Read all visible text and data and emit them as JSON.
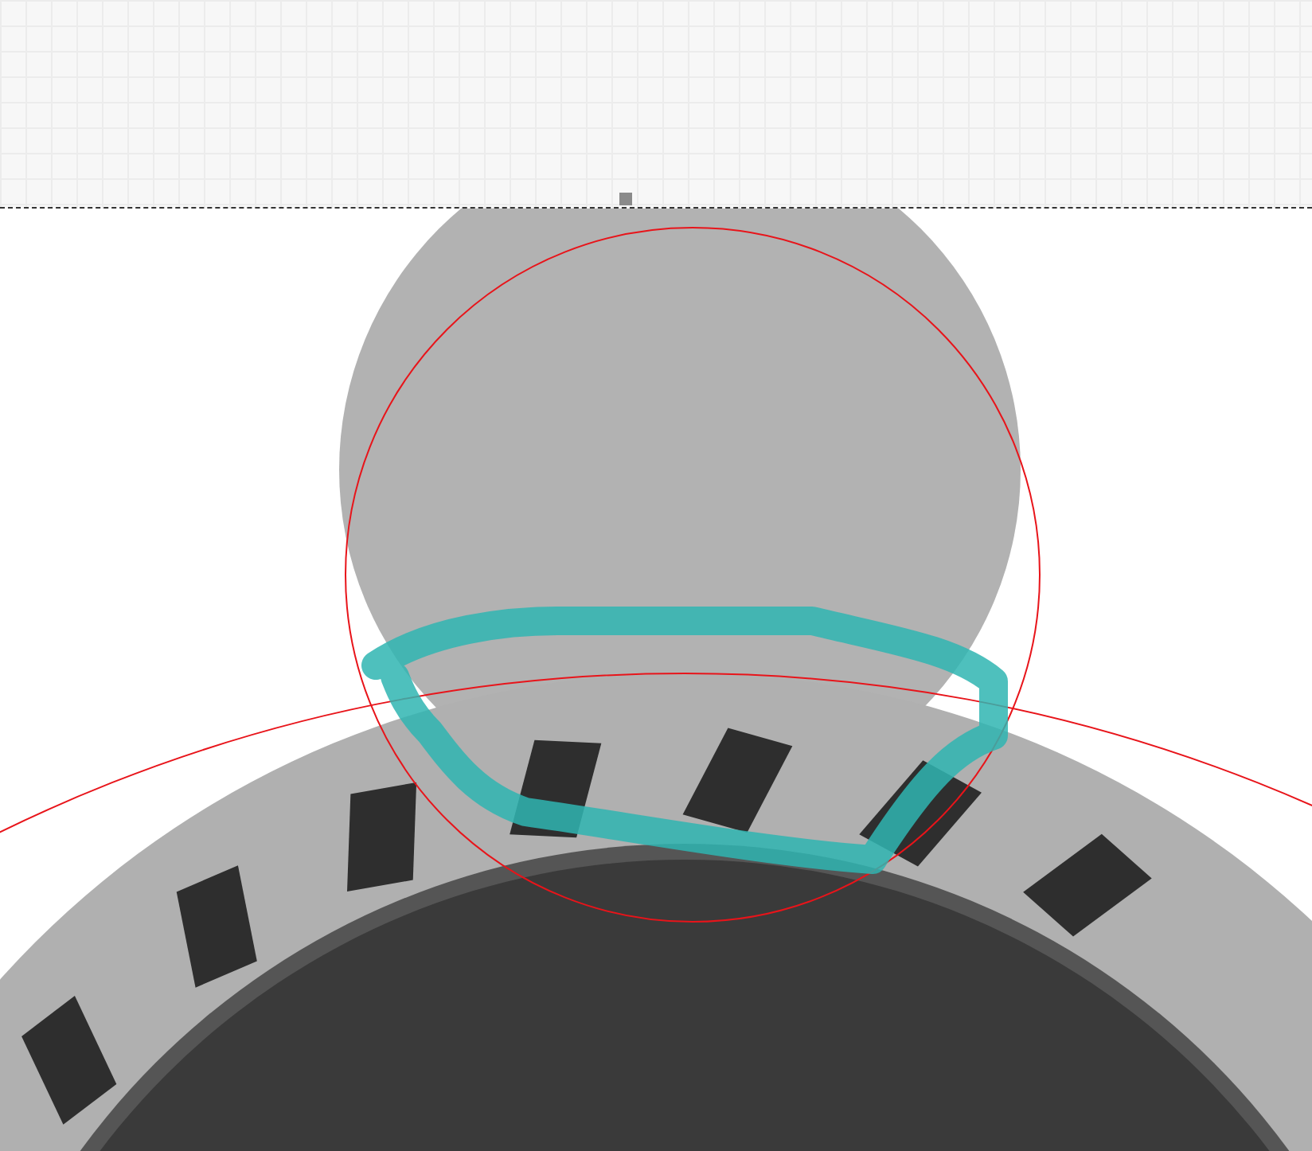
{
  "canvas": {
    "annotations": [
      {
        "kind": "circle"
      },
      {
        "kind": "circle"
      },
      {
        "kind": "stroke"
      }
    ]
  }
}
